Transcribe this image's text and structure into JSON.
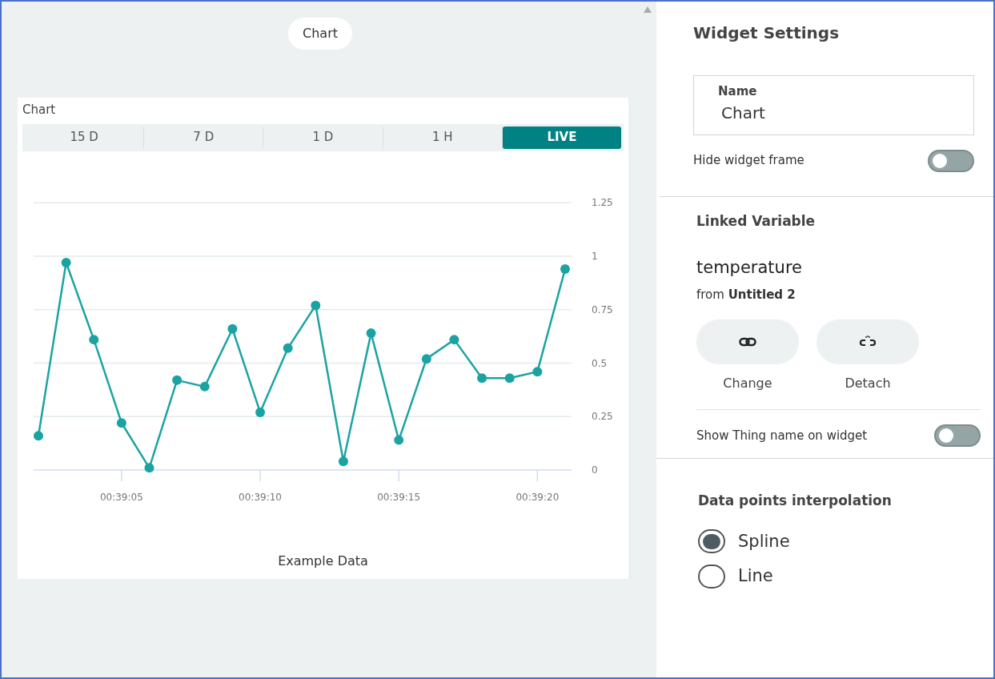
{
  "canvas": {
    "widget_label": "Chart"
  },
  "chart_widget": {
    "title": "Chart",
    "ranges": [
      {
        "label": "15 D",
        "selected": false
      },
      {
        "label": "7 D",
        "selected": false
      },
      {
        "label": "1 D",
        "selected": false
      },
      {
        "label": "1 H",
        "selected": false
      },
      {
        "label": "LIVE",
        "selected": true
      }
    ],
    "chart_data": {
      "type": "line",
      "categories": [
        null,
        null,
        null,
        "00:39:05",
        null,
        null,
        null,
        null,
        "00:39:10",
        null,
        null,
        null,
        null,
        "00:39:15",
        null,
        null,
        null,
        null,
        "00:39:20",
        null
      ],
      "grid": true,
      "series": [
        {
          "name": "Example Data",
          "color": "#1ba3a3",
          "marker": "circle",
          "values": [
            0.16,
            0.97,
            0.61,
            0.22,
            0.01,
            0.42,
            0.39,
            0.66,
            0.27,
            0.57,
            0.77,
            0.04,
            0.64,
            0.14,
            0.52,
            0.61,
            0.43,
            0.43,
            0.46,
            0.94
          ]
        }
      ],
      "yticks": [
        {
          "value": 0,
          "label": "0"
        },
        {
          "value": 0.25,
          "label": "0.25"
        },
        {
          "value": 0.5,
          "label": "0.5"
        },
        {
          "value": 0.75,
          "label": "0.75"
        },
        {
          "value": 1,
          "label": "1"
        },
        {
          "value": 1.25,
          "label": "1.25"
        }
      ],
      "ylim": [
        0,
        1.25
      ]
    }
  },
  "settings": {
    "title": "Widget Settings",
    "name_field": {
      "label": "Name",
      "value": "Chart"
    },
    "hide_frame": {
      "label": "Hide widget frame",
      "on": false
    },
    "linked_variable": {
      "title": "Linked Variable",
      "variable": "temperature",
      "source": "from **Untitled 2**",
      "actions": [
        {
          "kind": "link",
          "label": "Change"
        },
        {
          "kind": "unlink",
          "label": "Detach"
        }
      ],
      "show_thing_name": {
        "label": "Show Thing name on widget",
        "on": false
      }
    },
    "interpolation": {
      "title": "Data points interpolation",
      "options": [
        {
          "label": "Spline",
          "selected": true
        },
        {
          "label": "Line",
          "selected": false
        }
      ]
    }
  }
}
